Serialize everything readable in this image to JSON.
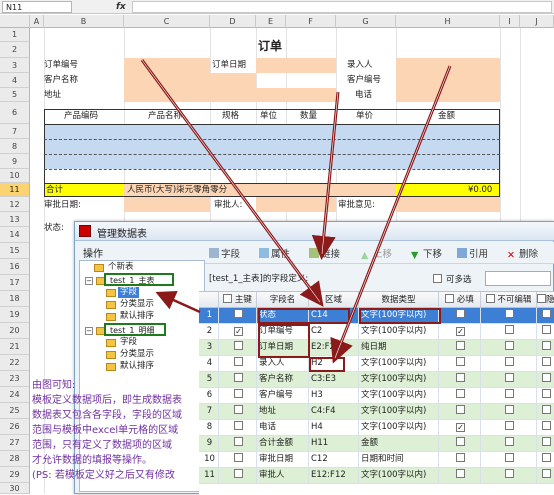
{
  "formula_bar": {
    "name_box": "N11",
    "fx": "fx"
  },
  "columns": [
    "A",
    "B",
    "C",
    "D",
    "E",
    "F",
    "G",
    "H",
    "I",
    "J"
  ],
  "rows": [
    "1",
    "2",
    "3",
    "4",
    "5",
    "6",
    "7",
    "8",
    "9",
    "10",
    "11",
    "12",
    "13",
    "14",
    "15",
    "16",
    "17",
    "18",
    "19",
    "20",
    "21",
    "22",
    "23",
    "24",
    "25",
    "26",
    "27",
    "28",
    "29",
    "30",
    "31",
    "32"
  ],
  "sheet": {
    "title": "订单",
    "order_no": "订单编号",
    "order_date": "订单日期",
    "entry_person": "录入人",
    "customer_name": "客户名称",
    "customer_no": "客户编号",
    "address": "地址",
    "phone": "电话",
    "h_product_code": "产品编码",
    "h_product_name": "产品名称",
    "h_spec": "规格",
    "h_unit": "单位",
    "h_qty": "数量",
    "h_price": "单价",
    "h_amount": "金额",
    "total": "合计",
    "rmb_upper": "人民币(大写)柒元零角零分",
    "total_amount": "¥0.00",
    "review_date": "审批日期:",
    "reviewer": "审批人:",
    "review_opinion": "审批意见:",
    "status": "状态:"
  },
  "dialog": {
    "title": "管理数据表",
    "left_header": "操作",
    "tree": [
      {
        "label": "个新表",
        "level": 1
      },
      {
        "label": "test_1_主表",
        "level": 1
      },
      {
        "label": "字段",
        "level": 2
      },
      {
        "label": "分类显示",
        "level": 2
      },
      {
        "label": "默认排序",
        "level": 2
      },
      {
        "label": "test_1_明细",
        "level": 1
      },
      {
        "label": "字段",
        "level": 2
      },
      {
        "label": "分类显示",
        "level": 2
      },
      {
        "label": "默认排序",
        "level": 2
      }
    ],
    "toolbar": {
      "field": "字段",
      "property": "属性",
      "link": "链接",
      "up": "上移",
      "down": "下移",
      "reference": "引用",
      "delete": "删除"
    },
    "def_label": "[test_1_主表]的字段定义:",
    "multi_select": "可多选",
    "table_headers": [
      "",
      "主键",
      "字段名",
      "区域",
      "数据类型",
      "必填",
      "不可编辑",
      "隐"
    ],
    "table_rows": [
      {
        "n": "1",
        "pk": false,
        "name": "状态",
        "range": "C14",
        "type": "文字(100字以内)",
        "req": false,
        "ro": false,
        "color": "blue"
      },
      {
        "n": "2",
        "pk": true,
        "name": "订单编号",
        "range": "C2",
        "type": "文字(100字以内)",
        "req": true,
        "ro": false,
        "color": "white"
      },
      {
        "n": "3",
        "pk": false,
        "name": "订单日期",
        "range": "E2:F2",
        "type": "纯日期",
        "req": false,
        "ro": false,
        "color": "green"
      },
      {
        "n": "4",
        "pk": false,
        "name": "录入人",
        "range": "H2",
        "type": "文字(100字以内)",
        "req": false,
        "ro": false,
        "color": "white"
      },
      {
        "n": "5",
        "pk": false,
        "name": "客户名称",
        "range": "C3:E3",
        "type": "文字(100字以内)",
        "req": false,
        "ro": false,
        "color": "green"
      },
      {
        "n": "6",
        "pk": false,
        "name": "客户编号",
        "range": "H3",
        "type": "文字(100字以内)",
        "req": false,
        "ro": false,
        "color": "white"
      },
      {
        "n": "7",
        "pk": false,
        "name": "地址",
        "range": "C4:F4",
        "type": "文字(100字以内)",
        "req": false,
        "ro": false,
        "color": "green"
      },
      {
        "n": "8",
        "pk": false,
        "name": "电话",
        "range": "H4",
        "type": "文字(100字以内)",
        "req": true,
        "ro": false,
        "color": "white"
      },
      {
        "n": "9",
        "pk": false,
        "name": "合计金额",
        "range": "H11",
        "type": "金额",
        "req": false,
        "ro": false,
        "color": "green"
      },
      {
        "n": "10",
        "pk": false,
        "name": "审批日期",
        "range": "C12",
        "type": "日期和时间",
        "req": false,
        "ro": false,
        "color": "white"
      },
      {
        "n": "11",
        "pk": false,
        "name": "审批人",
        "range": "E12:F12",
        "type": "文字(100字以内)",
        "req": false,
        "ro": false,
        "color": "green"
      }
    ]
  },
  "note": {
    "line1": "由图可知:",
    "line2": "模板定义数据项后，即生成数据表",
    "line3": "数据表又包含各字段，字段的区域",
    "line4": "范围与模板中excel单元格的区域",
    "line5": "范围，只有定义了数据项的区域",
    "line6": "才允许数据的填报等操作。",
    "line7": "(PS: 若模板定义好之后又有修改"
  },
  "colors": {
    "peach": "#fcd5b4",
    "blue": "#c5d9f1",
    "arrow": "#8b1a1a",
    "note": "#7030a0"
  }
}
